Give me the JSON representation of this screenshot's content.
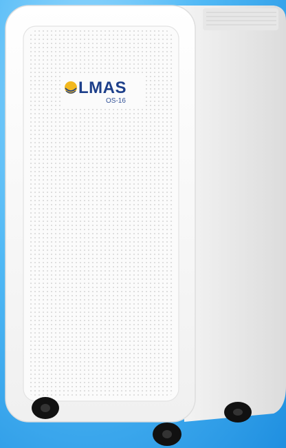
{
  "product": {
    "brand": "LMAS",
    "model": "OS-16"
  },
  "colors": {
    "background": "#4fb8f5",
    "body": "#f3f3f3",
    "brand_blue": "#1d3f8a",
    "logo_gold": "#f2b81f",
    "wheels": "#111111"
  }
}
